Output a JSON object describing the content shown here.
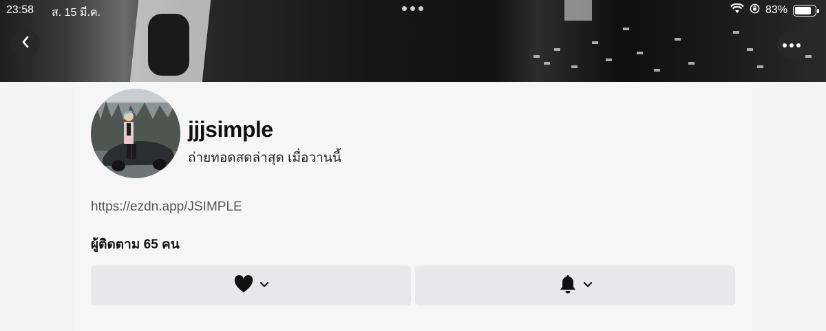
{
  "status_bar": {
    "time": "23:58",
    "date": "ส. 15 มี.ค.",
    "battery_percent": "83%",
    "battery_level": 0.83
  },
  "header": {
    "back_icon": "chevron-left-icon",
    "more_icon": "ellipsis-icon"
  },
  "profile": {
    "username": "jjjsimple",
    "last_live": "ถ่ายทอดสดล่าสุด เมื่อวานนี้",
    "link": "https://ezdn.app/JSIMPLE",
    "followers": "ผู้ติดตาม 65 คน"
  },
  "actions": {
    "like_icon": "heart-icon",
    "notify_icon": "bell-icon",
    "dropdown_icon": "chevron-down-icon"
  },
  "colors": {
    "background": "#f4f4f5",
    "button_bg": "#e8e8ea",
    "text": "#111111"
  }
}
